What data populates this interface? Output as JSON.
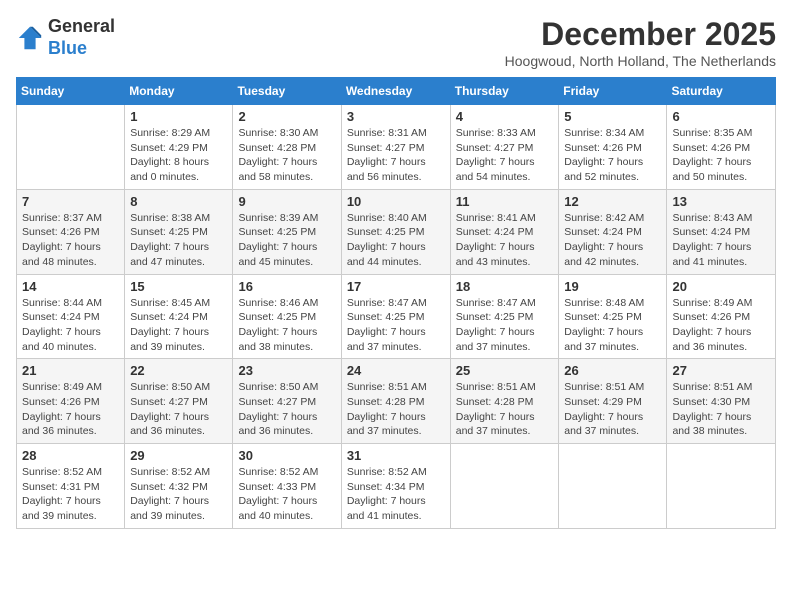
{
  "logo": {
    "general": "General",
    "blue": "Blue"
  },
  "title": {
    "month": "December 2025",
    "location": "Hoogwoud, North Holland, The Netherlands"
  },
  "weekdays": [
    "Sunday",
    "Monday",
    "Tuesday",
    "Wednesday",
    "Thursday",
    "Friday",
    "Saturday"
  ],
  "weeks": [
    [
      {
        "day": "",
        "info": ""
      },
      {
        "day": "1",
        "info": "Sunrise: 8:29 AM\nSunset: 4:29 PM\nDaylight: 8 hours\nand 0 minutes."
      },
      {
        "day": "2",
        "info": "Sunrise: 8:30 AM\nSunset: 4:28 PM\nDaylight: 7 hours\nand 58 minutes."
      },
      {
        "day": "3",
        "info": "Sunrise: 8:31 AM\nSunset: 4:27 PM\nDaylight: 7 hours\nand 56 minutes."
      },
      {
        "day": "4",
        "info": "Sunrise: 8:33 AM\nSunset: 4:27 PM\nDaylight: 7 hours\nand 54 minutes."
      },
      {
        "day": "5",
        "info": "Sunrise: 8:34 AM\nSunset: 4:26 PM\nDaylight: 7 hours\nand 52 minutes."
      },
      {
        "day": "6",
        "info": "Sunrise: 8:35 AM\nSunset: 4:26 PM\nDaylight: 7 hours\nand 50 minutes."
      }
    ],
    [
      {
        "day": "7",
        "info": "Sunrise: 8:37 AM\nSunset: 4:26 PM\nDaylight: 7 hours\nand 48 minutes."
      },
      {
        "day": "8",
        "info": "Sunrise: 8:38 AM\nSunset: 4:25 PM\nDaylight: 7 hours\nand 47 minutes."
      },
      {
        "day": "9",
        "info": "Sunrise: 8:39 AM\nSunset: 4:25 PM\nDaylight: 7 hours\nand 45 minutes."
      },
      {
        "day": "10",
        "info": "Sunrise: 8:40 AM\nSunset: 4:25 PM\nDaylight: 7 hours\nand 44 minutes."
      },
      {
        "day": "11",
        "info": "Sunrise: 8:41 AM\nSunset: 4:24 PM\nDaylight: 7 hours\nand 43 minutes."
      },
      {
        "day": "12",
        "info": "Sunrise: 8:42 AM\nSunset: 4:24 PM\nDaylight: 7 hours\nand 42 minutes."
      },
      {
        "day": "13",
        "info": "Sunrise: 8:43 AM\nSunset: 4:24 PM\nDaylight: 7 hours\nand 41 minutes."
      }
    ],
    [
      {
        "day": "14",
        "info": "Sunrise: 8:44 AM\nSunset: 4:24 PM\nDaylight: 7 hours\nand 40 minutes."
      },
      {
        "day": "15",
        "info": "Sunrise: 8:45 AM\nSunset: 4:24 PM\nDaylight: 7 hours\nand 39 minutes."
      },
      {
        "day": "16",
        "info": "Sunrise: 8:46 AM\nSunset: 4:25 PM\nDaylight: 7 hours\nand 38 minutes."
      },
      {
        "day": "17",
        "info": "Sunrise: 8:47 AM\nSunset: 4:25 PM\nDaylight: 7 hours\nand 37 minutes."
      },
      {
        "day": "18",
        "info": "Sunrise: 8:47 AM\nSunset: 4:25 PM\nDaylight: 7 hours\nand 37 minutes."
      },
      {
        "day": "19",
        "info": "Sunrise: 8:48 AM\nSunset: 4:25 PM\nDaylight: 7 hours\nand 37 minutes."
      },
      {
        "day": "20",
        "info": "Sunrise: 8:49 AM\nSunset: 4:26 PM\nDaylight: 7 hours\nand 36 minutes."
      }
    ],
    [
      {
        "day": "21",
        "info": "Sunrise: 8:49 AM\nSunset: 4:26 PM\nDaylight: 7 hours\nand 36 minutes."
      },
      {
        "day": "22",
        "info": "Sunrise: 8:50 AM\nSunset: 4:27 PM\nDaylight: 7 hours\nand 36 minutes."
      },
      {
        "day": "23",
        "info": "Sunrise: 8:50 AM\nSunset: 4:27 PM\nDaylight: 7 hours\nand 36 minutes."
      },
      {
        "day": "24",
        "info": "Sunrise: 8:51 AM\nSunset: 4:28 PM\nDaylight: 7 hours\nand 37 minutes."
      },
      {
        "day": "25",
        "info": "Sunrise: 8:51 AM\nSunset: 4:28 PM\nDaylight: 7 hours\nand 37 minutes."
      },
      {
        "day": "26",
        "info": "Sunrise: 8:51 AM\nSunset: 4:29 PM\nDaylight: 7 hours\nand 37 minutes."
      },
      {
        "day": "27",
        "info": "Sunrise: 8:51 AM\nSunset: 4:30 PM\nDaylight: 7 hours\nand 38 minutes."
      }
    ],
    [
      {
        "day": "28",
        "info": "Sunrise: 8:52 AM\nSunset: 4:31 PM\nDaylight: 7 hours\nand 39 minutes."
      },
      {
        "day": "29",
        "info": "Sunrise: 8:52 AM\nSunset: 4:32 PM\nDaylight: 7 hours\nand 39 minutes."
      },
      {
        "day": "30",
        "info": "Sunrise: 8:52 AM\nSunset: 4:33 PM\nDaylight: 7 hours\nand 40 minutes."
      },
      {
        "day": "31",
        "info": "Sunrise: 8:52 AM\nSunset: 4:34 PM\nDaylight: 7 hours\nand 41 minutes."
      },
      {
        "day": "",
        "info": ""
      },
      {
        "day": "",
        "info": ""
      },
      {
        "day": "",
        "info": ""
      }
    ]
  ]
}
